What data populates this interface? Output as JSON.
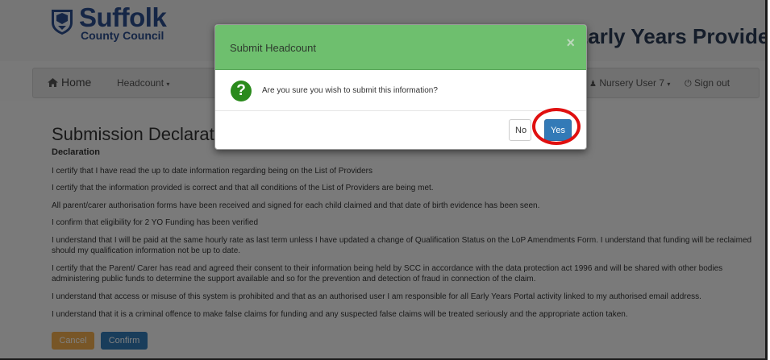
{
  "header": {
    "logo_name": "Suffolk",
    "logo_subtitle": "County Council",
    "portal_title": "Early Years Provider Portal"
  },
  "nav": {
    "home": "Home",
    "headcount": "Headcount",
    "user": "Nursery User 7",
    "signout": "Sign out"
  },
  "page": {
    "heading": "Submission Declaration",
    "declaration_title": "Declaration",
    "paragraphs": [
      "I certify that I have read the up to date information regarding being on the List of Providers",
      "I certify that the information provided is correct and that all conditions of the List of Providers are being met.",
      "All parent/carer authorisation forms have been received and signed for each child claimed and that date of birth evidence has been seen.",
      "I confirm that eligibility for 2 YO Funding has been verified",
      "I understand that I will be paid at the same hourly rate as last term unless I have updated a change of Qualification Status on the LoP Amendments Form. I understand that funding will be reclaimed should my qualification information not be up to date.",
      "I certify that the Parent/ Carer has read and agreed their consent to their information being held by SCC in accordance with the data protection act 1996 and will be shared with other bodies administering public funds to determine the support available and so for the prevention and detection of fraud in connection of the claim.",
      "I understand that access or misuse of this system is prohibited and that as an authorised user I am responsible for all Early Years Portal activity linked to my authorised email address.",
      "I understand that it is a criminal offence to make false claims for funding and any suspected false claims will be treated seriously and the appropriate action taken."
    ],
    "cancel": "Cancel",
    "confirm": "Confirm"
  },
  "modal": {
    "title": "Submit Headcount",
    "close": "×",
    "question_icon": "?",
    "message": "Are you sure you wish to submit this information?",
    "no": "No",
    "yes": "Yes"
  },
  "colors": {
    "modal_header": "#6ebf6e",
    "primary": "#337ab7",
    "warning": "#f0ad4e",
    "highlight_ring": "#e01010",
    "brand": "#2b4c8c"
  },
  "icons": {
    "logo": "suffolk-shield-icon",
    "home": "home-icon",
    "user": "user-icon",
    "signout": "power-icon",
    "dropdown": "caret-down-icon",
    "question": "question-circle-icon"
  }
}
